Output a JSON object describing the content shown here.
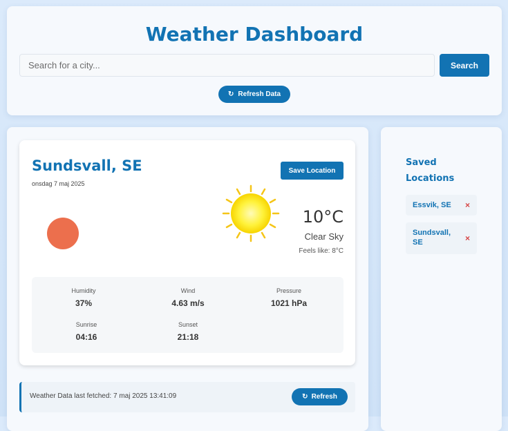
{
  "header": {
    "title": "Weather Dashboard",
    "search_placeholder": "Search for a city...",
    "search_button": "Search",
    "refresh_button": "Refresh Data",
    "refresh_icon": "↻"
  },
  "weather": {
    "city": "Sundsvall, SE",
    "date": "onsdag 7 maj 2025",
    "save_button": "Save Location",
    "temperature": "10°C",
    "condition": "Clear Sky",
    "feels_like_label": "Feels like:",
    "feels_like_value": "8°C",
    "icon": "sun-icon",
    "details": {
      "humidity_label": "Humidity",
      "humidity": "37%",
      "wind_label": "Wind",
      "wind": "4.63 m/s",
      "pressure_label": "Pressure",
      "pressure": "1021 hPa",
      "sunrise_label": "Sunrise",
      "sunrise": "04:16",
      "sunset_label": "Sunset",
      "sunset": "21:18"
    }
  },
  "fetched": {
    "label": "Weather Data last fetched:",
    "timestamp": "7 maj 2025 13:41:09",
    "button": "Refresh",
    "icon": "↻"
  },
  "saved": {
    "title": "Saved Locations",
    "items": [
      {
        "name": "Essvik, SE",
        "remove": "×"
      },
      {
        "name": "Sundsvall, SE",
        "remove": "×"
      }
    ]
  },
  "colors": {
    "primary": "#1273b3",
    "sun": "#ffe600",
    "sun_ray": "#f5c518",
    "orange_dot": "#ec6f4d",
    "remove": "#d64545"
  }
}
